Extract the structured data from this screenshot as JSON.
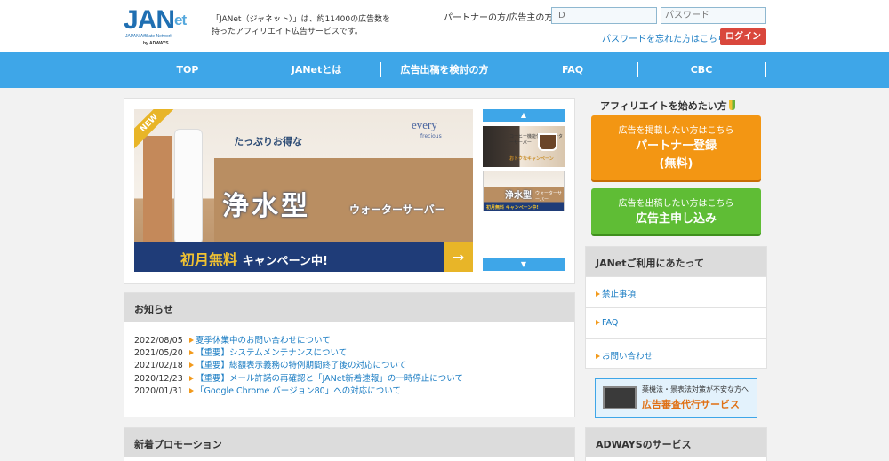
{
  "header": {
    "logo_text": "JANet",
    "logo_subtitle": "JAPAN Affiliate Network",
    "logo_by": "by ADWAYS",
    "intro_text": "「JANet（ジャネット）」は、約11400の広告数を持ったアフィリエイト広告サービスです。",
    "partner_label": "パートナーの方/広告主の方",
    "id_placeholder": "ID",
    "password_placeholder": "パスワード",
    "forgot_password": "パスワードを忘れた方はこちら",
    "login_button": "ログイン"
  },
  "nav": {
    "items": [
      {
        "label": "TOP"
      },
      {
        "label": "JANetとは"
      },
      {
        "label": "広告出稿を検討の方"
      },
      {
        "label": "FAQ"
      },
      {
        "label": "CBC"
      }
    ]
  },
  "hero": {
    "ribbon": "NEW",
    "tagline": "たっぷりお得な",
    "brand": "every",
    "brand_sub": "frecious",
    "title": "浄水型",
    "subtitle": "ウォーターサーバー",
    "banner_highlight": "初月無料",
    "banner_rest": "キャンペーン中!",
    "banner_arrow": "→"
  },
  "thumbnails": {
    "up_arrow": "▲",
    "down_arrow": "▼",
    "thumb1_text": "コーヒー機能付きウォーターサーバー",
    "thumb1_text2": "おトクなキャンペーン",
    "thumb2_title": "浄水型",
    "thumb2_sub": "ウォーターサーバー",
    "thumb2_banner": "初月無料 キャンペーン中!"
  },
  "news": {
    "heading": "お知らせ",
    "items": [
      {
        "date": "2022/08/05",
        "title": "夏季休業中のお問い合わせについて"
      },
      {
        "date": "2021/05/20",
        "title": "【重要】システムメンテナンスについて"
      },
      {
        "date": "2021/02/18",
        "title": "【重要】総額表示義務の特例期間終了後の対応について"
      },
      {
        "date": "2020/12/23",
        "title": "【重要】メール許諾の再確認と「JANet新着速報」の一時停止について"
      },
      {
        "date": "2020/01/31",
        "title": "「Google Chrome バージョン80」への対応について"
      }
    ]
  },
  "promo": {
    "heading": "新着プロモーション"
  },
  "sidebar": {
    "affiliate_heading": "アフィリエイトを始めたい方",
    "partner_cta": {
      "sub": "広告を掲載したい方はこちら",
      "main_line1": "パートナー登録",
      "main_line2": "(無料)"
    },
    "advertiser_cta": {
      "sub": "広告を出稿したい方はこちら",
      "main": "広告主申し込み"
    },
    "info_heading": "JANetご利用にあたって",
    "info_items": [
      {
        "label": "禁止事項"
      },
      {
        "label": "FAQ"
      },
      {
        "label": "お問い合わせ"
      }
    ],
    "review_banner": {
      "line1": "薬機法・景表法対策が不安な方へ",
      "line2": "広告審査代行サービス"
    },
    "adways_heading": "ADWAYSのサービス"
  },
  "colors": {
    "nav_blue": "#3ea6e8",
    "login_red": "#d9473c",
    "cta_orange": "#f39613",
    "cta_green": "#5fbd35",
    "link_blue": "#1a7cc3"
  }
}
